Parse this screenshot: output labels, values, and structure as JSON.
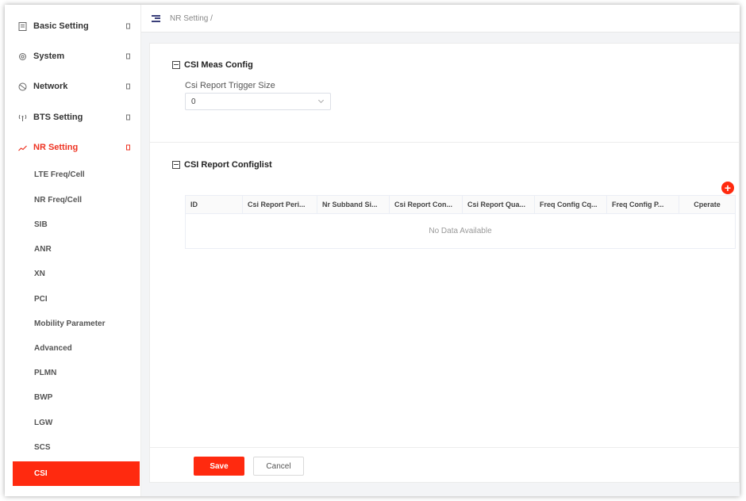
{
  "sidebar": {
    "menus": [
      {
        "label": "Basic Setting",
        "icon": "document-icon"
      },
      {
        "label": "System",
        "icon": "gear-icon"
      },
      {
        "label": "Network",
        "icon": "globe-icon"
      },
      {
        "label": "BTS Setting",
        "icon": "antenna-icon"
      },
      {
        "label": "NR Setting",
        "icon": "signal-icon"
      }
    ],
    "submenu": [
      "LTE Freq/Cell",
      "NR Freq/Cell",
      "SIB",
      "ANR",
      "XN",
      "PCI",
      "Mobility Parameter",
      "Advanced",
      "PLMN",
      "BWP",
      "LGW",
      "SCS",
      "CSI"
    ],
    "selected_item": "CSI"
  },
  "breadcrumb": "NR Setting /",
  "csi_meas": {
    "title": "CSI Meas Config",
    "trigger_label": "Csi Report Trigger Size",
    "trigger_value": "0"
  },
  "configlist": {
    "title": "CSI Report Configlist",
    "add_label": "+",
    "columns": [
      "ID",
      "Csi Report Peri...",
      "Nr Subband Si...",
      "Csi Report Con...",
      "Csi Report Qua...",
      "Freq Config Cq...",
      "Freq Config P...",
      "Cperate"
    ],
    "empty_text": "No Data Available"
  },
  "actions": {
    "save": "Save",
    "cancel": "Cancel"
  },
  "colors": {
    "accent": "#ff2a0f",
    "nav_dark": "#3a3f7a"
  }
}
